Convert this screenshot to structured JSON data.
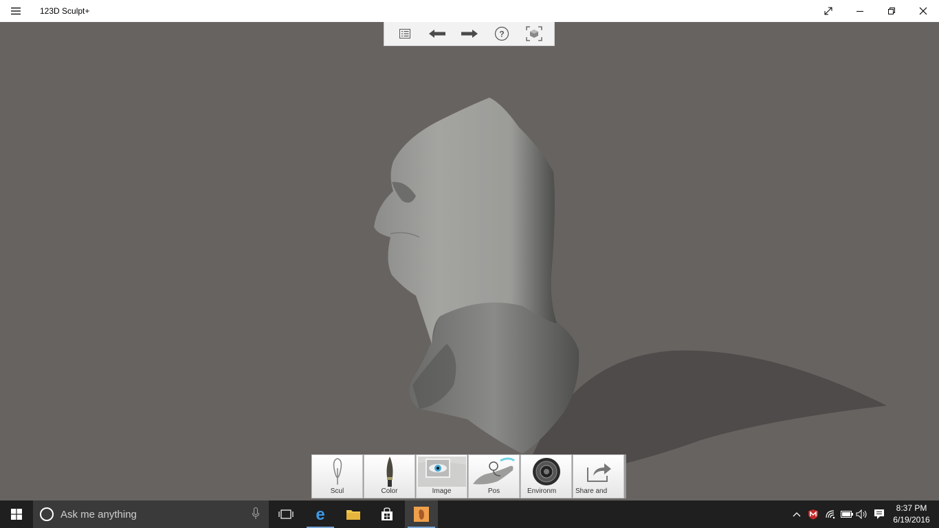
{
  "window": {
    "title": "123D Sculpt+"
  },
  "top_toolbar": {
    "items": [
      {
        "name": "list-icon"
      },
      {
        "name": "undo-arrow-icon"
      },
      {
        "name": "redo-arrow-icon"
      },
      {
        "name": "help-icon"
      },
      {
        "name": "frame-view-icon"
      }
    ]
  },
  "palette": {
    "tools": [
      {
        "label": "Scul",
        "icon": "sculpt-tool-icon"
      },
      {
        "label": "Color",
        "icon": "paint-brush-icon"
      },
      {
        "label": "Image",
        "icon": "eye-image-icon"
      },
      {
        "label": "Pos",
        "icon": "pose-hand-icon"
      },
      {
        "label": "Environm",
        "icon": "environment-lens-icon"
      },
      {
        "label": "Share and",
        "icon": "share-arrow-icon"
      }
    ]
  },
  "taskbar": {
    "search_placeholder": "Ask me anything",
    "time": "8:37 PM",
    "date": "6/19/2016"
  },
  "colors": {
    "background": "#676361",
    "taskbar": "#1f1f1f",
    "accent": "#7aa7d8"
  }
}
